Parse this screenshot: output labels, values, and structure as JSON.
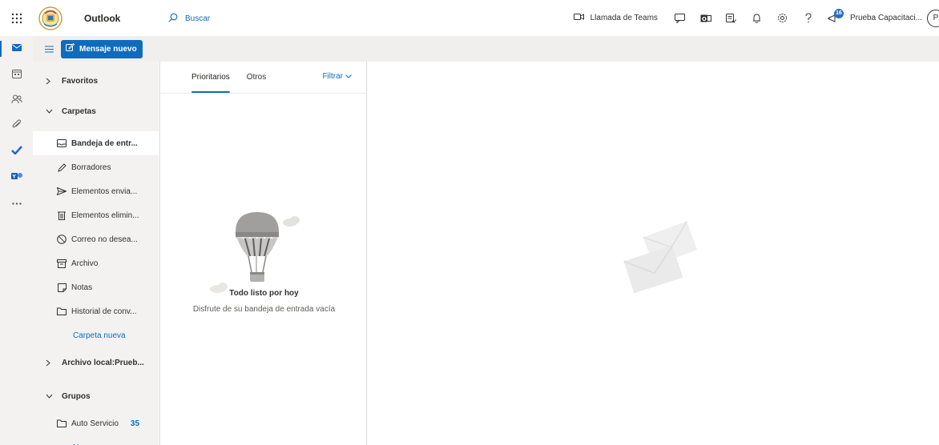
{
  "header": {
    "app_title": "Outlook",
    "search_placeholder": "Buscar",
    "teams_call_label": "Llamada de Teams",
    "notifications_badge": "16",
    "user_name": "Prueba Capacitaci...",
    "avatar_initial": "P"
  },
  "toolbar": {
    "new_message_label": "Mensaje nuevo"
  },
  "rail": {
    "items": [
      "mail-icon",
      "calendar-icon",
      "people-icon",
      "attach-icon",
      "todo-icon",
      "yammer-icon",
      "more-icon"
    ]
  },
  "folders": {
    "favorites_label": "Favoritos",
    "folders_label": "Carpetas",
    "items": [
      {
        "label": "Bandeja de entr...",
        "icon": "inbox-icon"
      },
      {
        "label": "Borradores",
        "icon": "pencil-icon"
      },
      {
        "label": "Elementos envia...",
        "icon": "send-icon"
      },
      {
        "label": "Elementos elimin...",
        "icon": "trash-icon"
      },
      {
        "label": "Correo no desea...",
        "icon": "block-icon"
      },
      {
        "label": "Archivo",
        "icon": "archive-icon"
      },
      {
        "label": "Notas",
        "icon": "note-icon"
      },
      {
        "label": "Historial de conv...",
        "icon": "folder-icon"
      }
    ],
    "new_folder_label": "Carpeta nueva",
    "local_archive_label": "Archivo local:Prueb...",
    "groups_label": "Grupos",
    "groups_items": [
      {
        "label": "Auto Servicio",
        "count": "35",
        "icon": "folder-icon"
      }
    ],
    "new_group_label": "Nuevo grupo"
  },
  "list": {
    "tab_primary": "Prioritarios",
    "tab_other": "Otros",
    "filter_label": "Filtrar",
    "empty_title": "Todo listo por hoy",
    "empty_subtitle": "Disfrute de su bandeja de entrada vacía"
  },
  "colors": {
    "accent": "#0f6cbd",
    "rail_bg": "#f3f2f1",
    "header_bg": "#ffffff"
  }
}
